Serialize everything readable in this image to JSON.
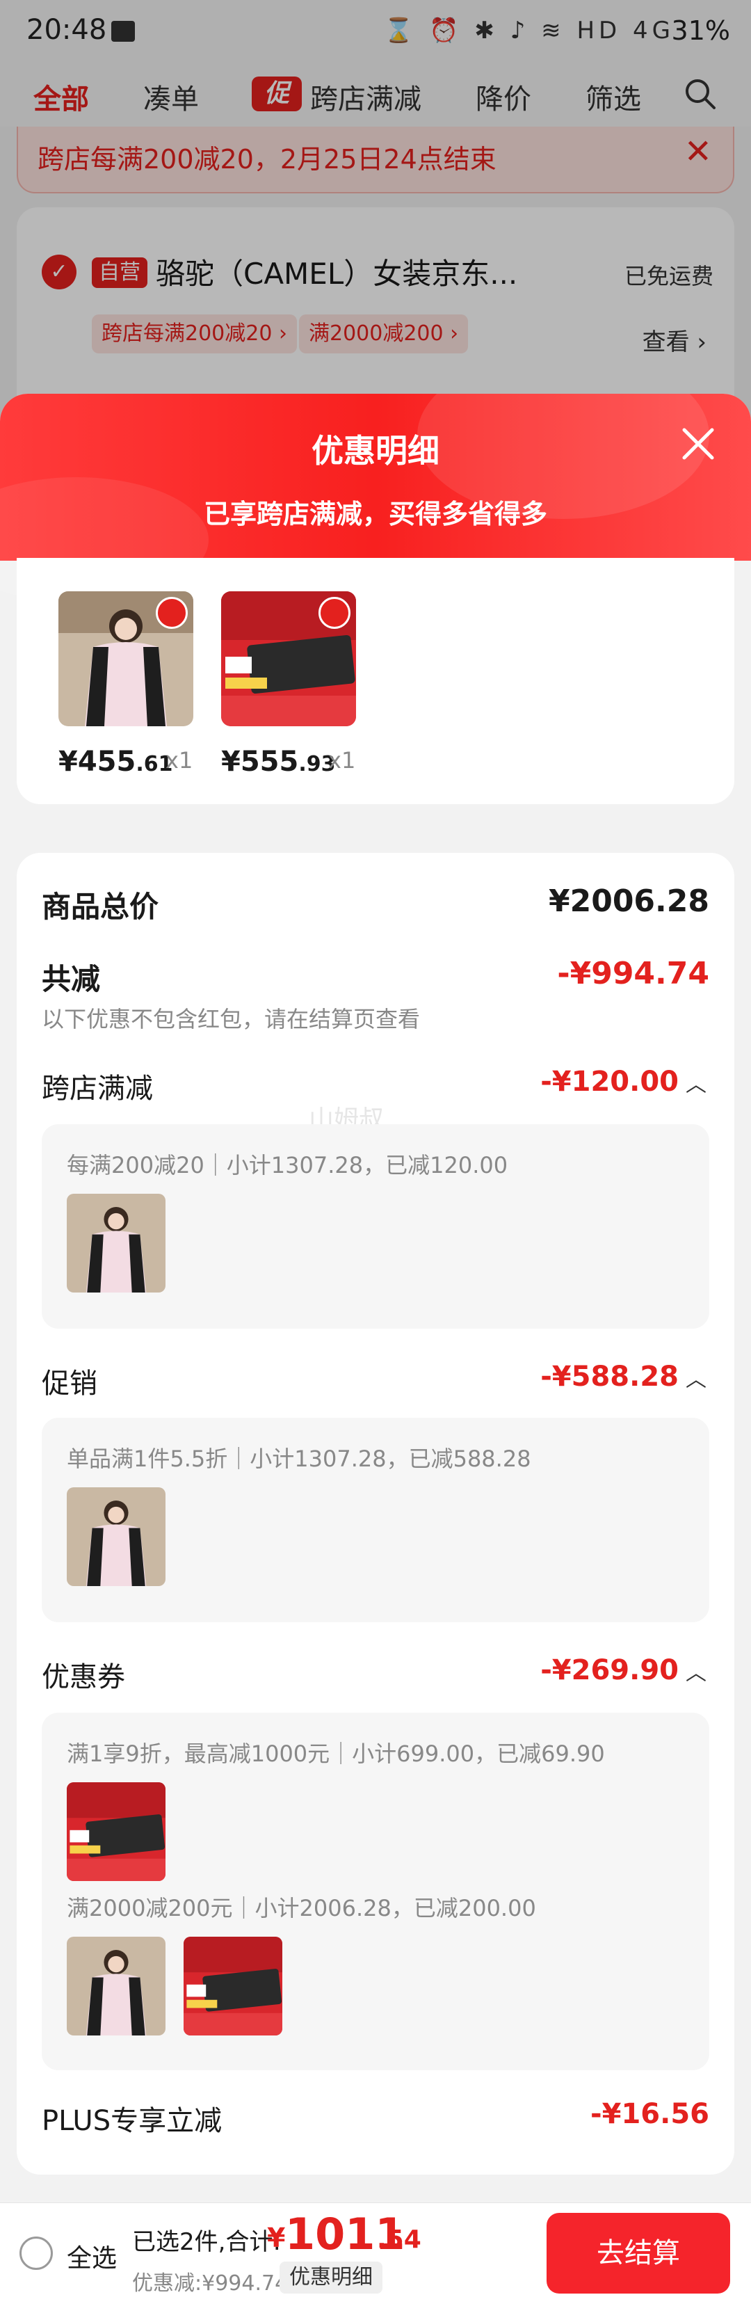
{
  "status_bar": {
    "time": "20:48",
    "icons": "⌛ ⏰ ✱ ♪ ≋ HD 4G",
    "battery": "31%"
  },
  "tabs": [
    {
      "label": "全部",
      "active": true
    },
    {
      "label": "凑单"
    },
    {
      "label": "跨店满减",
      "promo_icon": "促"
    },
    {
      "label": "降价"
    },
    {
      "label": "筛选"
    }
  ],
  "notice": {
    "text": "跨店每满200减20，2月25日24点结束",
    "close": "✕"
  },
  "background_card": {
    "tag": "自营",
    "shop": "骆驼（CAMEL）女装京东...",
    "shipping": "已免运费",
    "pills": [
      "跨店每满200减20 ›",
      "满2000减200 ›"
    ],
    "view": "查看 ›"
  },
  "sheet": {
    "title": "优惠明细",
    "subtitle": "已享跨店满减，买得多省得多"
  },
  "products": [
    {
      "price_int": "¥455",
      "price_dec": ".61",
      "qty": "x1"
    },
    {
      "price_int": "¥555",
      "price_dec": ".93",
      "qty": "x1"
    }
  ],
  "detail": {
    "total_label": "商品总价",
    "total_value": "¥2006.28",
    "reduce_label": "共减",
    "reduce_value": "-¥994.74",
    "reduce_note": "以下优惠不包含红包，请在结算页查看",
    "watermark": "山姆叔",
    "sections": [
      {
        "label": "跨店满减",
        "value": "-¥120.00",
        "rules": [
          {
            "text": "每满200减20｜小计1307.28，已减120.00"
          }
        ]
      },
      {
        "label": "促销",
        "value": "-¥588.28",
        "rules": [
          {
            "text": "单品满1件5.5折｜小计1307.28，已减588.28"
          }
        ]
      },
      {
        "label": "优惠券",
        "value": "-¥269.90",
        "rules": [
          {
            "text": "满1享9折，最高减1000元｜小计699.00，已减69.90"
          },
          {
            "text": "满2000减200元｜小计2006.28，已减200.00"
          }
        ]
      }
    ],
    "plus_label": "PLUS专享立减",
    "plus_value": "-¥16.56"
  },
  "bottom": {
    "select_all": "全选",
    "summary": "已选2件,合计:",
    "yen": "¥",
    "total_int": "1011",
    "total_dec": ".54",
    "savings": "优惠减:¥994.74",
    "detail_btn": "优惠明细",
    "checkout": "去结算"
  },
  "colors": {
    "accent": "#e3211e",
    "checkout": "#f5242b",
    "pink": "#fde2de"
  }
}
